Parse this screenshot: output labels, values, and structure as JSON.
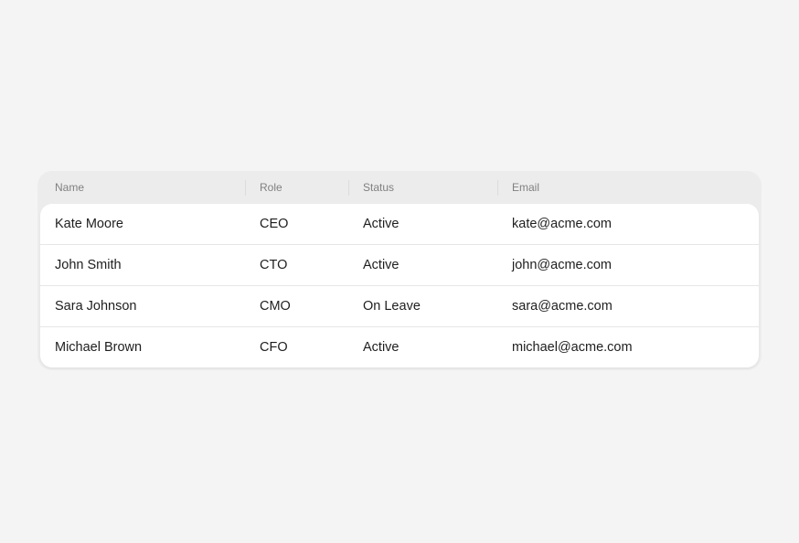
{
  "table": {
    "columns": [
      "Name",
      "Role",
      "Status",
      "Email"
    ],
    "rows": [
      {
        "name": "Kate Moore",
        "role": "CEO",
        "status": "Active",
        "email": "kate@acme.com"
      },
      {
        "name": "John Smith",
        "role": "CTO",
        "status": "Active",
        "email": "john@acme.com"
      },
      {
        "name": "Sara Johnson",
        "role": "CMO",
        "status": "On Leave",
        "email": "sara@acme.com"
      },
      {
        "name": "Michael Brown",
        "role": "CFO",
        "status": "Active",
        "email": "michael@acme.com"
      }
    ]
  }
}
